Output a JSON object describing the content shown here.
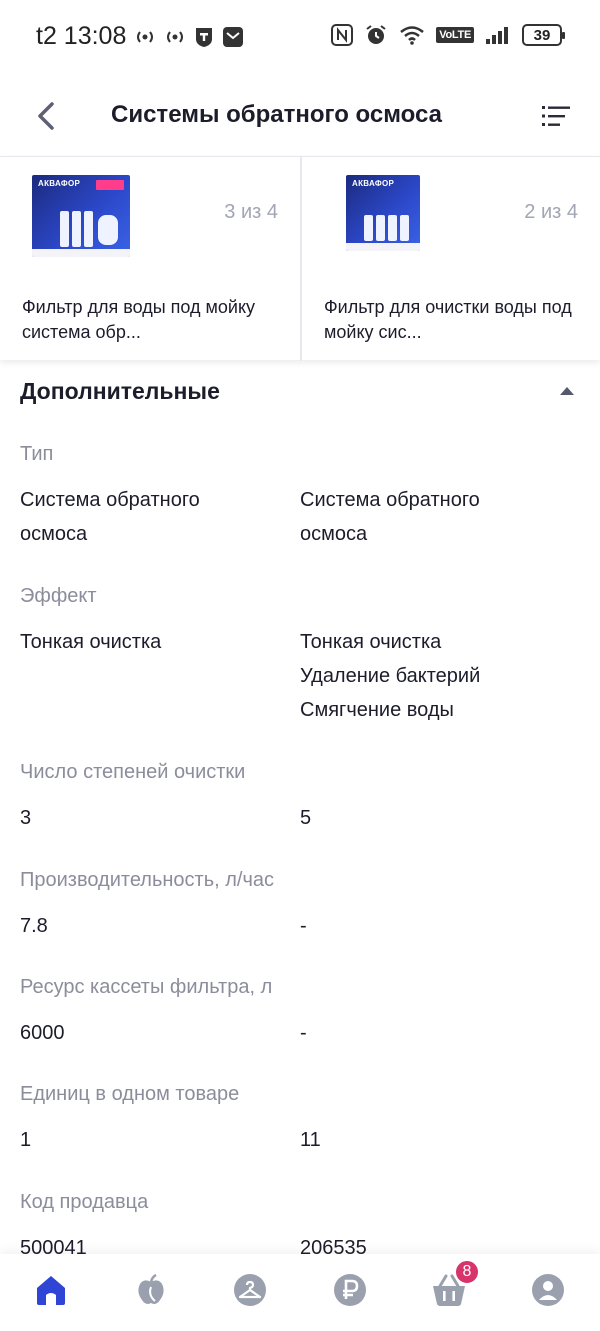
{
  "status_bar": {
    "time": "t2 13:08",
    "battery": "39",
    "network_badge": "VoLTE"
  },
  "header": {
    "title": "Системы обратного осмоса",
    "back_icon": "chevron-left-icon",
    "menu_icon": "list-icon"
  },
  "products": [
    {
      "name": "Фильтр для воды под мойку система обр...",
      "counter": "3 из 4",
      "brand": "АКВАФОР"
    },
    {
      "name": "Фильтр для очистки воды под мойку сис...",
      "counter": "2 из 4",
      "brand": "АКВАФОР"
    }
  ],
  "section": {
    "title": "Дополнительные",
    "state": "expanded"
  },
  "specs": [
    {
      "label": "Тип",
      "values": [
        [
          "Система обратного",
          "осмоса"
        ],
        [
          "Система обратного",
          "осмоса"
        ]
      ]
    },
    {
      "label": "Эффект",
      "values": [
        [
          "Тонкая очистка"
        ],
        [
          "Тонкая очистка",
          "Удаление бактерий",
          "Смягчение воды"
        ]
      ]
    },
    {
      "label": "Число степеней очистки",
      "values": [
        [
          "3"
        ],
        [
          "5"
        ]
      ]
    },
    {
      "label": "Производительность, л/час",
      "values": [
        [
          "7.8"
        ],
        [
          "-"
        ]
      ]
    },
    {
      "label": "Ресурс кассеты фильтра, л",
      "values": [
        [
          "6000"
        ],
        [
          "-"
        ]
      ]
    },
    {
      "label": "Единиц в одном товаре",
      "values": [
        [
          "1"
        ],
        [
          "11"
        ]
      ]
    },
    {
      "label": "Код продавца",
      "values": [
        [
          "500041"
        ],
        [
          "206535"
        ]
      ]
    }
  ],
  "bottom_nav": {
    "items": [
      "home",
      "catalog",
      "profile-wardrobe",
      "payments",
      "cart",
      "account"
    ],
    "cart_badge": "8",
    "active_color": "#2f45d6",
    "inactive_color": "#9aa0ad"
  }
}
